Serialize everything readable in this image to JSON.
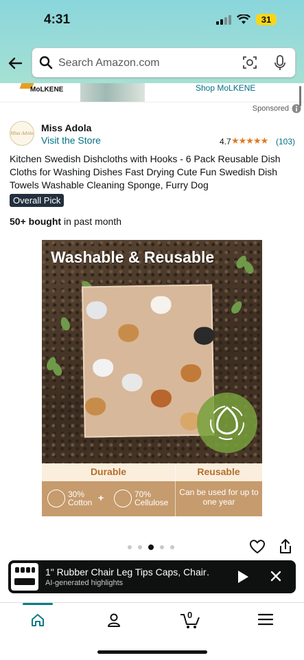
{
  "status_bar": {
    "time": "4:31",
    "battery": "31"
  },
  "search": {
    "placeholder": "Search Amazon.com"
  },
  "banner": {
    "brand": "MoLKENE",
    "link": "Shop MoLKENE"
  },
  "sponsored": {
    "label": "Sponsored"
  },
  "store": {
    "logo_text": "Miss Adola",
    "name": "Miss Adola",
    "visit_label": "Visit the Store"
  },
  "rating": {
    "value": "4.7",
    "stars": "★★★★★",
    "count": "(103)"
  },
  "product": {
    "title": "Kitchen Swedish Dishcloths with Hooks - 6 Pack Reusable Dish Cloths for Washing Dishes Fast Drying Cute Fun Swedish Dish Towels Washable Cleaning Sponge, Furry Dog",
    "badge": "Overall Pick",
    "bought_bold": "50+ bought",
    "bought_rest": " in past month"
  },
  "image": {
    "headline": "Washable & Reusable",
    "feature_left": "Durable",
    "feature_right": "Reusable",
    "cotton_pct": "30%",
    "cotton_label": "Cotton",
    "plus": "+",
    "cellulose_pct": "70%",
    "cellulose_label": "Cellulose",
    "reuse_text": "Can be used for up to one year"
  },
  "carousel": {
    "total": 5,
    "active_index": 2
  },
  "player": {
    "title": "1\" Rubber Chair Leg Tips Caps, Chair…",
    "subtitle": "AI-generated highlights"
  },
  "nav": {
    "cart_count": "0",
    "accent": "#0b7a8a"
  }
}
